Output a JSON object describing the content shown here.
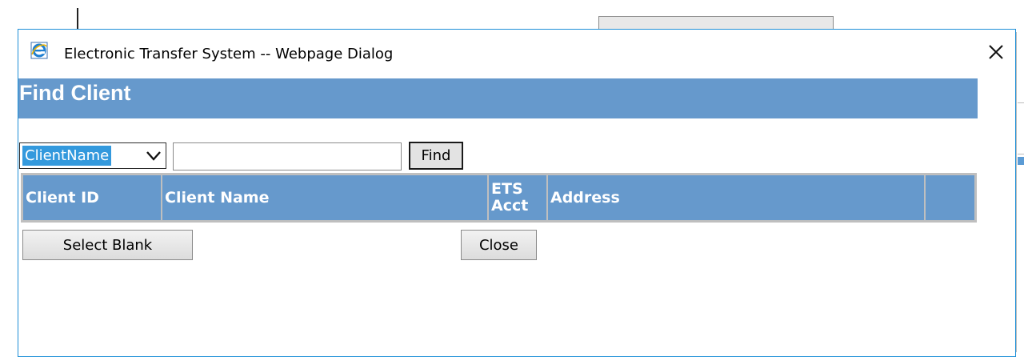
{
  "window": {
    "title": "Electronic Transfer System -- Webpage Dialog",
    "icon": "internet-explorer-icon",
    "close_icon": "close-icon"
  },
  "banner": {
    "title": "Find Client"
  },
  "search": {
    "field_selected": "ClientName",
    "input_value": "",
    "find_label": "Find"
  },
  "results_table": {
    "columns": [
      "Client ID",
      "Client Name",
      "ETS Acct",
      "Address",
      ""
    ],
    "rows": []
  },
  "actions": {
    "select_blank_label": "Select Blank",
    "close_label": "Close"
  },
  "colors": {
    "banner": "#6699cc",
    "header": "#6699cc",
    "select_highlight": "#3399dd",
    "dialog_border": "#1e90d8"
  }
}
